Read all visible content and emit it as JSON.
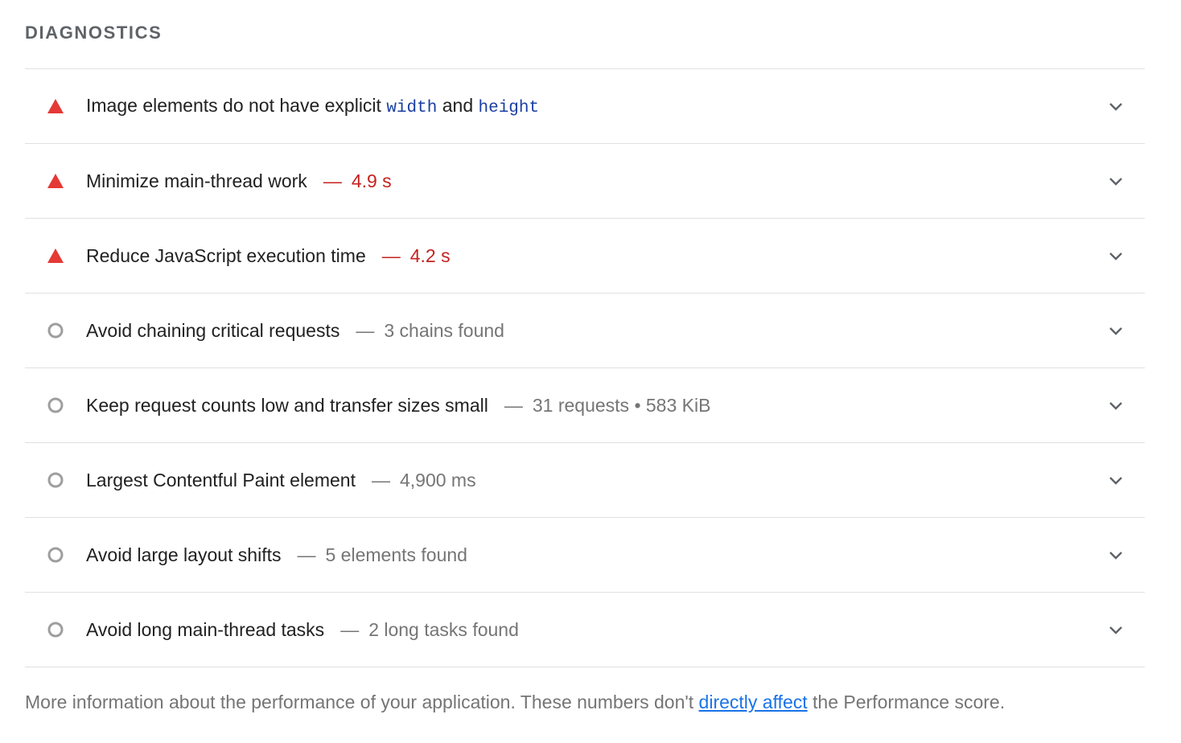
{
  "section": {
    "title": "DIAGNOSTICS"
  },
  "colors": {
    "fail": "#e53935",
    "info_icon": "#9e9e9e",
    "link": "#1a73e8",
    "code": "#1a3ea3"
  },
  "audits": [
    {
      "status": "fail",
      "icon": "warning-triangle-icon",
      "title_parts": [
        "Image elements do not have explicit ",
        "width",
        " and ",
        "height"
      ],
      "separator": "",
      "value": ""
    },
    {
      "status": "fail",
      "icon": "warning-triangle-icon",
      "title": "Minimize main-thread work",
      "separator": "—",
      "value": "4.9 s"
    },
    {
      "status": "fail",
      "icon": "warning-triangle-icon",
      "title": "Reduce JavaScript execution time",
      "separator": "—",
      "value": "4.2 s"
    },
    {
      "status": "info",
      "icon": "info-circle-icon",
      "title": "Avoid chaining critical requests",
      "separator": "—",
      "value": "3 chains found"
    },
    {
      "status": "info",
      "icon": "info-circle-icon",
      "title": "Keep request counts low and transfer sizes small",
      "separator": "—",
      "value": "31 requests • 583 KiB"
    },
    {
      "status": "info",
      "icon": "info-circle-icon",
      "title": "Largest Contentful Paint element",
      "separator": "—",
      "value": "4,900 ms"
    },
    {
      "status": "info",
      "icon": "info-circle-icon",
      "title": "Avoid large layout shifts",
      "separator": "—",
      "value": "5 elements found"
    },
    {
      "status": "info",
      "icon": "info-circle-icon",
      "title": "Avoid long main-thread tasks",
      "separator": "—",
      "value": "2 long tasks found"
    }
  ],
  "footer": {
    "text_before": "More information about the performance of your application. These numbers don't ",
    "link_text": "directly affect",
    "text_after": " the Performance score."
  }
}
